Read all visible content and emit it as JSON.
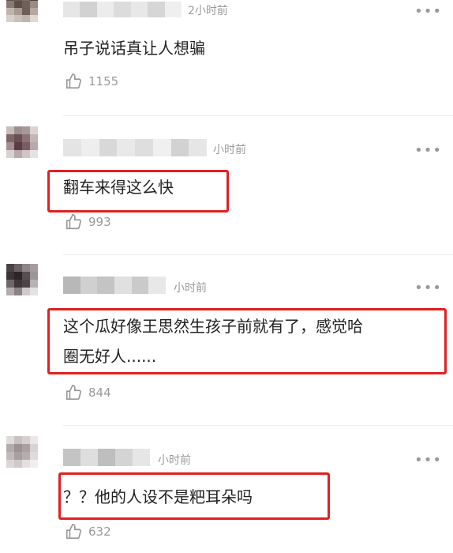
{
  "comments": [
    {
      "time": "2小时前",
      "text_lines": [
        "吊子说话真让人想骗"
      ],
      "likes": "1155",
      "highlighted": false
    },
    {
      "time": "小时前",
      "text_lines": [
        "翻车来得这么快"
      ],
      "likes": "993",
      "highlighted": true
    },
    {
      "time": "小时前",
      "text_lines": [
        "这个瓜好像王思然生孩子前就有了，感觉哈",
        "圈无好人......"
      ],
      "likes": "844",
      "highlighted": true
    },
    {
      "time": "小时前",
      "text_lines": [
        "？？他的人设不是粑耳朵吗"
      ],
      "likes": "632",
      "highlighted": true
    }
  ],
  "icons": {
    "more": "more-dots-icon",
    "like": "thumbs-up-icon"
  },
  "colors": {
    "highlight": "#e02020",
    "meta": "#9a9a9a",
    "text": "#222222"
  }
}
